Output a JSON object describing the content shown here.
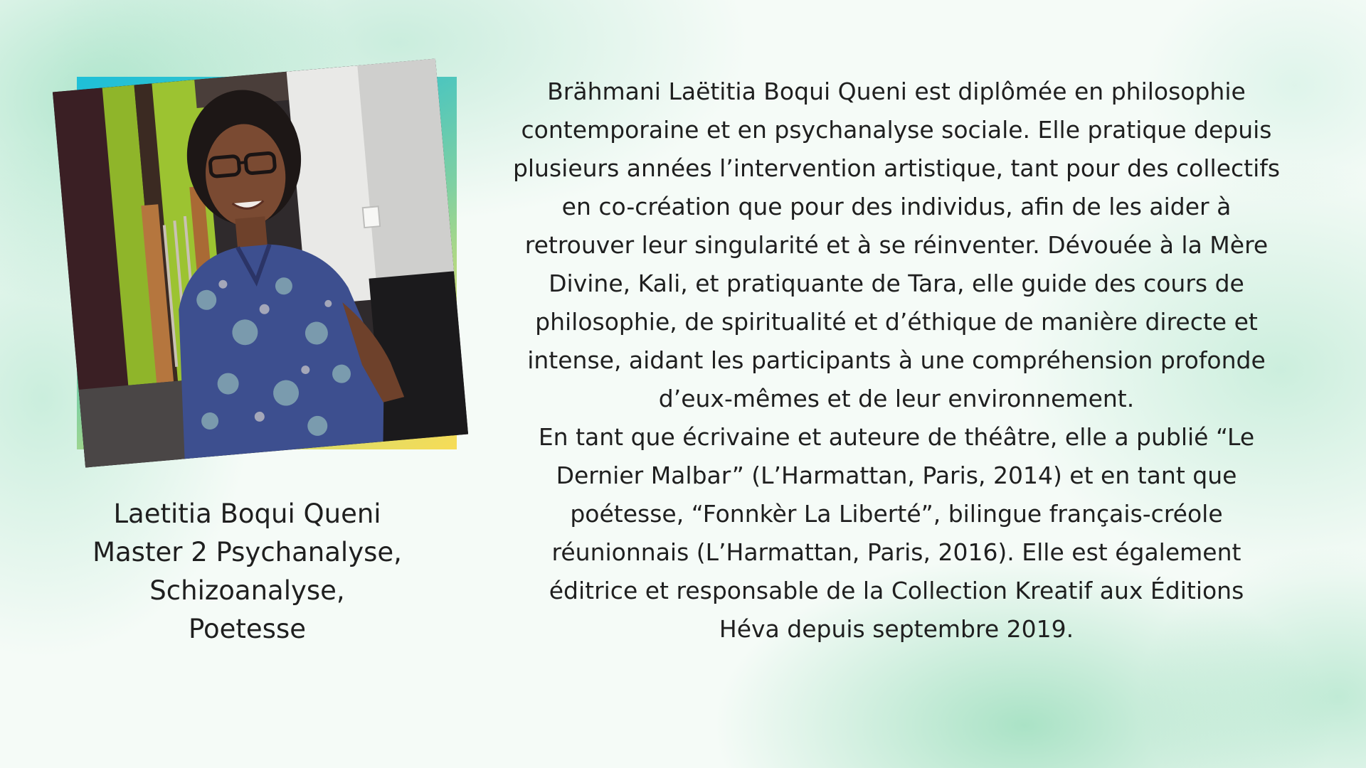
{
  "caption": {
    "name": "Laetitia Boqui Queni",
    "line2": "Master 2  Psychanalyse,",
    "line3": "Schizoanalyse,",
    "line4": "Poetesse"
  },
  "bio": {
    "lines": [
      "Brähmani Laëtitia Boqui Queni est diplômée en philosophie",
      "contemporaine et en psychanalyse sociale. Elle pratique depuis",
      "plusieurs années l’intervention artistique, tant pour des collectifs",
      "en co-création que pour des individus, afin de les aider à",
      "retrouver leur singularité et à se réinventer. Dévouée à la Mère",
      "Divine, Kali, et pratiquante de Tara, elle guide des cours de",
      "philosophie, de spiritualité et d’éthique de manière directe et",
      "intense, aidant les participants à une compréhension profonde",
      "d’eux-mêmes et de leur environnement.",
      "En tant que écrivaine et auteure de théâtre, elle a publié “Le",
      "Dernier Malbar” (L’Harmattan, Paris, 2014) et en tant que",
      "poétesse, “Fonnkèr La Liberté”, bilingue français-créole",
      "réunionnais (L’Harmattan, Paris, 2016). Elle est également",
      "éditrice et responsable de la Collection Kreatif aux Éditions",
      "Héva depuis septembre 2019."
    ]
  },
  "colors": {
    "frame_start": "#1ec0d8",
    "frame_end": "#f7dc57",
    "background_wash": "#78d4aa",
    "text": "#1f1f1f"
  }
}
